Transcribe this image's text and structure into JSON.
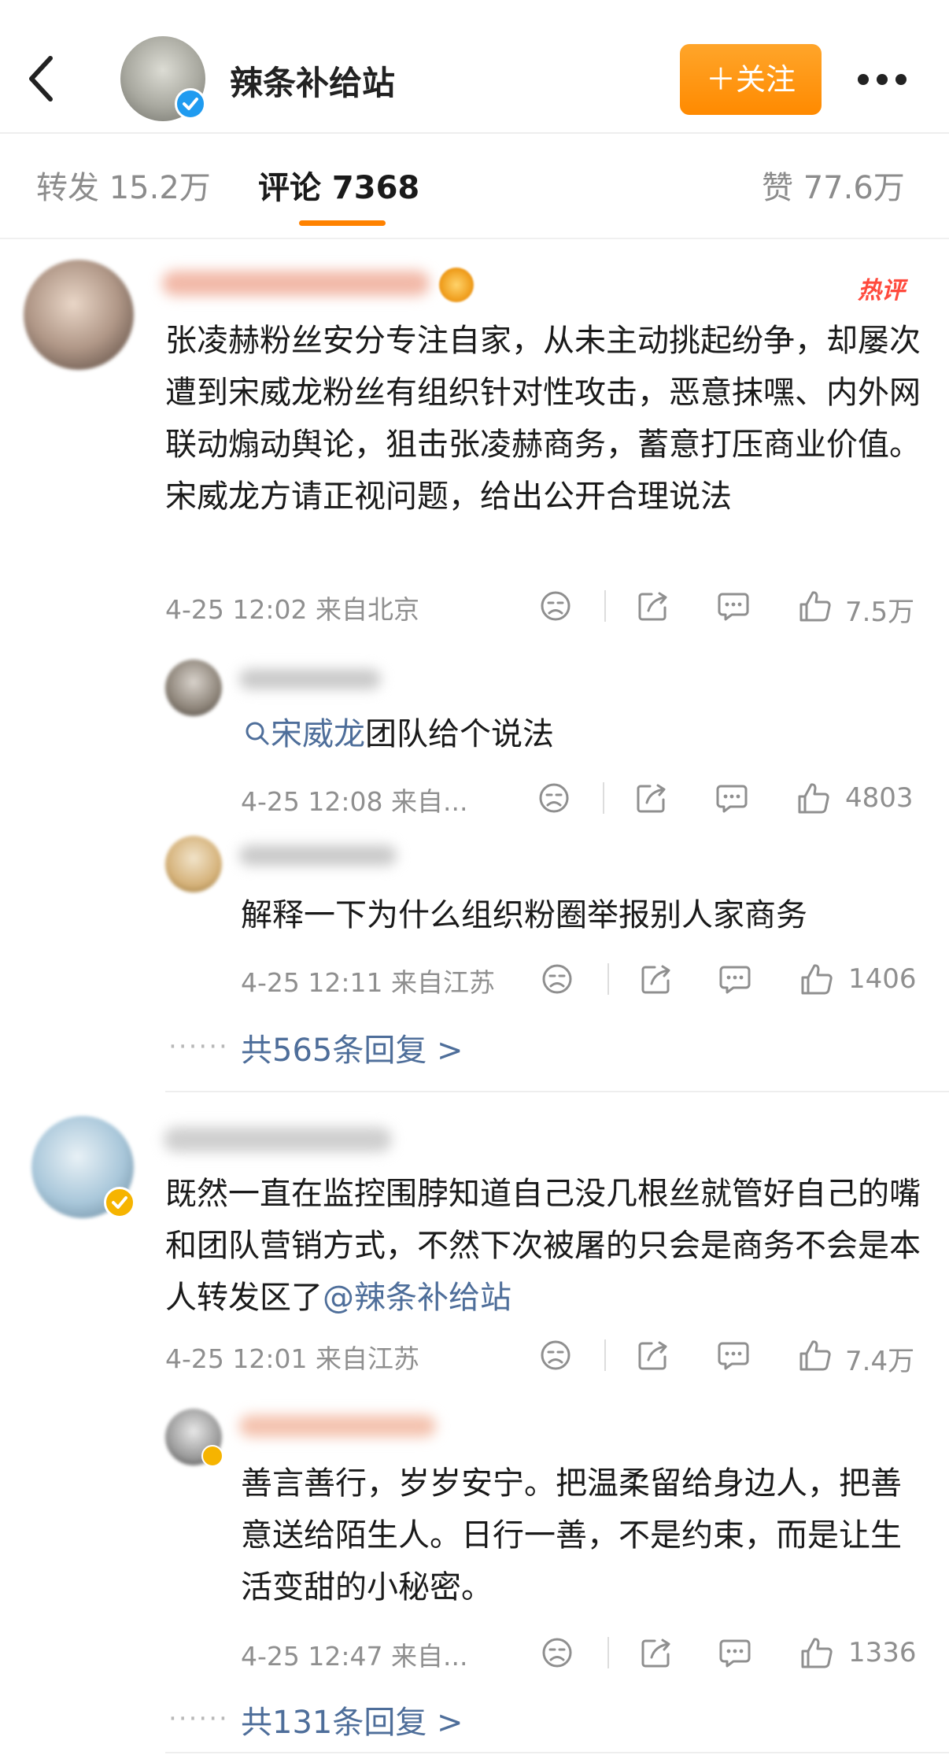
{
  "header": {
    "account_name": "辣条补给站",
    "follow_label": "＋关注",
    "back_icon": "chevron-left-icon",
    "more_icon": "more-dots-icon"
  },
  "tabs": [
    {
      "label": "转发 15.2万"
    },
    {
      "label": "评论 7368",
      "active": true
    },
    {
      "label": "赞 77.6万"
    }
  ],
  "colors": {
    "accent": "#ff8200",
    "link": "#4e6e9a",
    "verified_blue": "#1f9bf0",
    "verified_gold": "#f6b400",
    "hot": "#ff4a3d"
  },
  "comments": [
    {
      "badge": "热评",
      "text": "张凌赫粉丝安分专注自家，从未主动挑起纷争，却屡次遭到宋威龙粉丝有组织针对性攻击，恶意抹嘿、内外网联动煽动舆论，狙击张凌赫商务，蓄意打压商业价值。宋威龙方请正视问题，给出公开合理说法",
      "time": "4-25 12:02 来自北京",
      "likes": "7.5万",
      "replies": [
        {
          "search_term": "宋威龙",
          "text": "团队给个说法",
          "time": "4-25 12:08 来自...",
          "likes": "4803"
        },
        {
          "text": "解释一下为什么组织粉圈举报别人家商务",
          "time": "4-25 12:11 来自江苏",
          "likes": "1406"
        }
      ],
      "more_replies": "共565条回复 >"
    },
    {
      "text_before": "既然一直在监控围脖知道自己没几根丝就管好自己的嘴和团队营销方式，不然下次被屠的只会是商务不会是本人转发区了",
      "mention": "@辣条补给站",
      "time": "4-25 12:01 来自江苏",
      "likes": "7.4万",
      "replies": [
        {
          "text": "善言善行，岁岁安宁。把温柔留给身边人，把善意送给陌生人。日行一善，不是约束，而是让生活变甜的小秘密。",
          "time": "4-25 12:47 来自...",
          "likes": "1336"
        }
      ],
      "more_replies": "共131条回复 >"
    }
  ],
  "dots": "······",
  "icons": [
    "dislike-face-icon",
    "share-icon",
    "comment-icon",
    "like-icon",
    "search-icon",
    "verified-icon",
    "crown-icon"
  ]
}
